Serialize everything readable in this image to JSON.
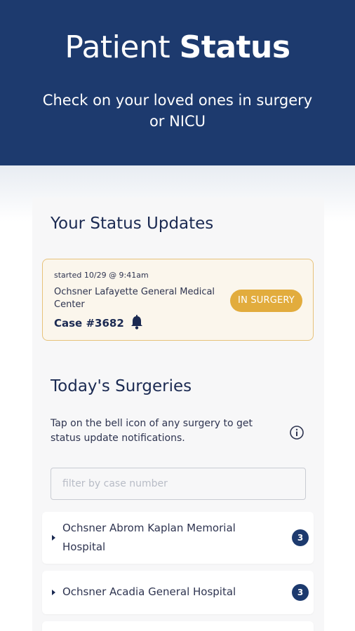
{
  "header": {
    "title_light": "Patient ",
    "title_bold": "Status",
    "subtitle": "Check on your loved ones in surgery or NICU"
  },
  "status_updates": {
    "title": "Your Status Updates",
    "card": {
      "started": "started 10/29 @ 9:41am",
      "hospital": "Ochsner Lafayette General Medical Center",
      "case": "Case #3682",
      "status": "IN SURGERY"
    }
  },
  "surgeries": {
    "title": "Today's Surgeries",
    "hint": "Tap on the bell icon of any surgery to get status update notifications.",
    "filter_placeholder": "filter by case number",
    "filter_value": "",
    "items": [
      {
        "name": "Ochsner Abrom Kaplan Memorial Hospital",
        "count": "3"
      },
      {
        "name": "Ochsner Acadia General Hospital",
        "count": "3"
      }
    ]
  },
  "colors": {
    "header_bg": "#1d3a6e",
    "badge": "#e2ac3d",
    "card_border": "#e7c27a"
  }
}
